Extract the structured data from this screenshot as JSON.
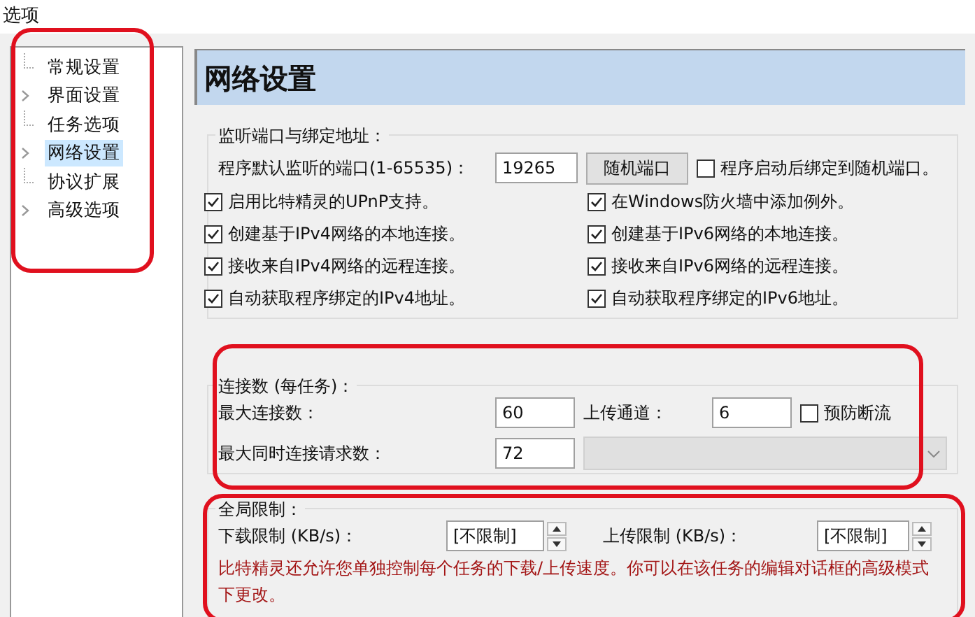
{
  "window": {
    "title": "选项"
  },
  "tree": {
    "items": [
      {
        "label": "常规设置",
        "expandable": false,
        "selected": false
      },
      {
        "label": "界面设置",
        "expandable": true,
        "selected": false
      },
      {
        "label": "任务选项",
        "expandable": false,
        "selected": false
      },
      {
        "label": "网络设置",
        "expandable": true,
        "selected": true
      },
      {
        "label": "协议扩展",
        "expandable": false,
        "selected": false
      },
      {
        "label": "高级选项",
        "expandable": true,
        "selected": false
      }
    ]
  },
  "page": {
    "title": "网络设置"
  },
  "listen_group": {
    "title": "监听端口与绑定地址：",
    "port_label": "程序默认监听的端口(1-65535)：",
    "port_value": "19265",
    "random_button": "随机端口",
    "bind_random": {
      "label": "程序启动后绑定到随机端口。",
      "checked": false
    },
    "options": [
      {
        "label": "启用比特精灵的UPnP支持。",
        "checked": true
      },
      {
        "label": "在Windows防火墙中添加例外。",
        "checked": true
      },
      {
        "label": "创建基于IPv4网络的本地连接。",
        "checked": true
      },
      {
        "label": "创建基于IPv6网络的本地连接。",
        "checked": true
      },
      {
        "label": "接收来自IPv4网络的远程连接。",
        "checked": true
      },
      {
        "label": "接收来自IPv6网络的远程连接。",
        "checked": true
      },
      {
        "label": "自动获取程序绑定的IPv4地址。",
        "checked": true
      },
      {
        "label": "自动获取程序绑定的IPv6地址。",
        "checked": true
      }
    ]
  },
  "connections_group": {
    "title": "连接数 (每任务)：",
    "max_connections_label": "最大连接数：",
    "max_connections_value": "60",
    "upload_slots_label": "上传通道：",
    "upload_slots_value": "6",
    "prevent_stall": {
      "label": "预防断流",
      "checked": false
    },
    "max_requests_label": "最大同时连接请求数：",
    "max_requests_value": "72",
    "dropdown": {
      "disabled": true
    }
  },
  "global_group": {
    "title": "全局限制：",
    "download_label": "下载限制 (KB/s)：",
    "download_value": "[不限制]",
    "upload_label": "上传限制 (KB/s)：",
    "upload_value": "[不限制]",
    "note": "比特精灵还允许您单独控制每个任务的下载/上传速度。你可以在该任务的编辑对话框的高级模式下更改。"
  }
}
